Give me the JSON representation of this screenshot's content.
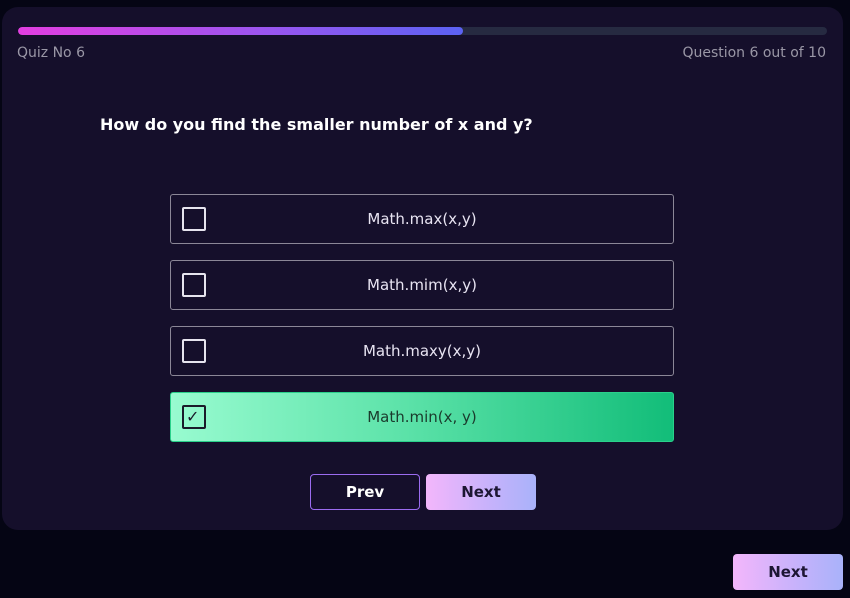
{
  "quiz": {
    "label": "Quiz No 6",
    "question_count": "Question 6 out of 10",
    "progress_percent": 55,
    "question": "How do you find the smaller number of x and y?",
    "options": [
      {
        "label": "Math.max(x,y)",
        "selected": false
      },
      {
        "label": "Math.mim(x,y)",
        "selected": false
      },
      {
        "label": "Math.maxy(x,y)",
        "selected": false
      },
      {
        "label": "Math.min(x, y)",
        "selected": true
      }
    ],
    "check_mark": "✓",
    "prev_label": "Prev",
    "next_label": "Next"
  },
  "footer": {
    "next_label": "Next"
  },
  "colors": {
    "background": "#050514",
    "card": "#150f2b",
    "selected_start": "#98fbd0",
    "selected_end": "#12bd79",
    "progress_start": "#e23ee0",
    "progress_end": "#5b62f3"
  }
}
